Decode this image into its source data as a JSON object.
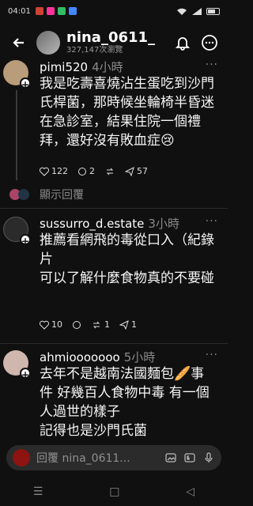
{
  "status": {
    "time": "04:01",
    "battery": "45"
  },
  "header": {
    "title": "nina_0611_",
    "views": "327,147次瀏覽"
  },
  "comments": [
    {
      "user": "pimi520",
      "time": "4小時",
      "text": "我是吃壽喜燒沾生蛋吃到沙門氏桿菌，那時候坐輪椅半昏迷在急診室，結果住院一個禮拜，還好沒有敗血症😢",
      "likes": "122",
      "replies": "2",
      "shares": "57"
    },
    {
      "user": "sussurro_d.estate",
      "time": "3小時",
      "text": "推薦看網飛的毒從口入（紀錄片\n可以了解什麼食物真的不要碰",
      "likes": "10",
      "reposts": "1",
      "shares": "1"
    },
    {
      "user": "ahmiooooooo",
      "time": "5小時",
      "text": "去年不是越南法國麵包🥖事件 好幾百人食物中毒 有一個人過世的樣子\n記得也是沙門氏菌"
    }
  ],
  "replies_link": "顯示回覆",
  "composer": {
    "placeholder": "回覆 nina_0611..."
  }
}
